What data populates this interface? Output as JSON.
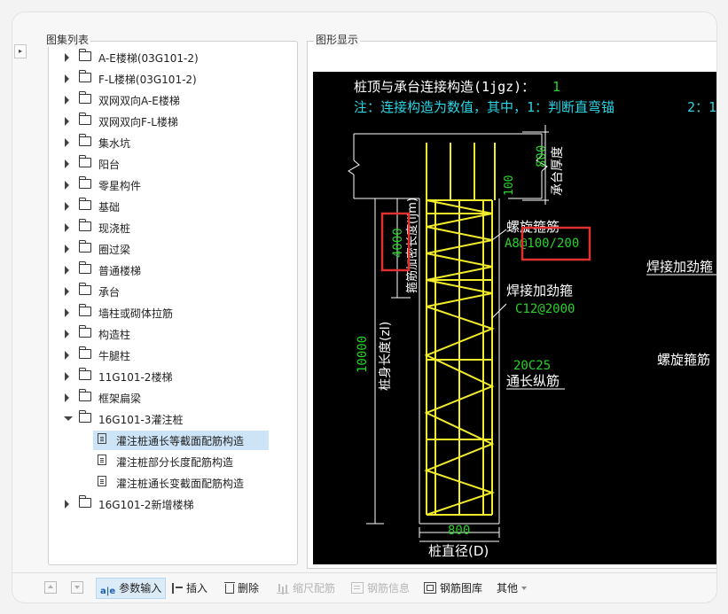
{
  "left_panel": {
    "title": "图集列表",
    "items": [
      {
        "label": "A-E楼梯(03G101-2)"
      },
      {
        "label": "F-L楼梯(03G101-2)"
      },
      {
        "label": "双网双向A-E楼梯"
      },
      {
        "label": "双网双向F-L楼梯"
      },
      {
        "label": "集水坑"
      },
      {
        "label": "阳台"
      },
      {
        "label": "零星构件"
      },
      {
        "label": "基础"
      },
      {
        "label": "现浇桩"
      },
      {
        "label": "圈过梁"
      },
      {
        "label": "普通楼梯"
      },
      {
        "label": "承台"
      },
      {
        "label": "墙柱或砌体拉筋"
      },
      {
        "label": "构造柱"
      },
      {
        "label": "牛腿柱"
      },
      {
        "label": "11G101-2楼梯"
      },
      {
        "label": "框架扁梁"
      },
      {
        "label": "16G101-3灌注桩"
      },
      {
        "label": "灌注桩通长等截面配筋构造"
      },
      {
        "label": "灌注桩部分长度配筋构造"
      },
      {
        "label": "灌注桩通长变截面配筋构造"
      },
      {
        "label": "16G101-2新增楼梯"
      }
    ]
  },
  "right_panel": {
    "title": "图形显示",
    "drawing": {
      "header_line1_prefix": "桩顶与承台连接构造(1jgz)：",
      "header_line1_value": "1",
      "header_line2": "注：连接构造为数值，其中，1：判断直弯锚",
      "header_line2_tail": "2：1",
      "cap_thickness_value": "800",
      "cap_thickness_label": "承台厚度",
      "anchor_top_value": "100",
      "anchor_length_value": "4000",
      "anchor_length_label": "箍筋加密长度(ljm)",
      "spiral_label": "螺旋箍筋",
      "spiral_value": "A8@100/200",
      "stiffener_label": "焊接加劲箍",
      "stiffener_value": "C12@2000",
      "right_stiffener_label": "焊接加劲箍",
      "right_spiral_label": "螺旋箍筋",
      "pile_length_label": "桩身长度(zl)",
      "pile_length_value": "10000",
      "long_bar_value": "20C25",
      "long_bar_label": "通长纵筋",
      "diameter_value": "800",
      "diameter_label": "桩直径(D)"
    },
    "colors": {
      "canvas_bg": "#000000",
      "cad_white": "#ffffff",
      "cad_green": "#28d228",
      "cad_cyan": "#29d6e6",
      "cad_yellow": "#f2ec2a",
      "highlight_red": "#e03131"
    }
  },
  "toolbar": {
    "param_input": "参数输入",
    "insert": "插入",
    "delete": "删除",
    "scale_rebar": "缩尺配筋",
    "rebar_info": "钢筋信息",
    "rebar_library": "钢筋图库",
    "more": "其他"
  }
}
